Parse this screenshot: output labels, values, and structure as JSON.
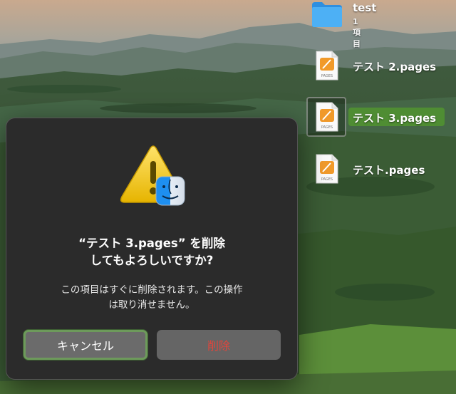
{
  "desktop": {
    "folder": {
      "name": "test",
      "count": "1項目",
      "icon": "folder-icon"
    },
    "files": [
      {
        "name": "テスト 2.pages",
        "icon_badge": "PAGES",
        "selected": false
      },
      {
        "name": "テスト 3.pages",
        "icon_badge": "PAGES",
        "selected": true
      },
      {
        "name": "テスト.pages",
        "icon_badge": "PAGES",
        "selected": false
      }
    ]
  },
  "dialog": {
    "icon": "warning-finder-icon",
    "title_line1": "“テスト 3.pages” を削除",
    "title_line2": "してもよろしいですか?",
    "message_line1": "この項目はすぐに削除されます。この操作",
    "message_line2": "は取り消せません。",
    "buttons": {
      "cancel": "キャンセル",
      "delete": "削除"
    }
  },
  "colors": {
    "selection_green": "#4f8d33",
    "focus_ring": "#6d9a5b",
    "destructive_red": "#e0463c",
    "dialog_bg": "#2b2b2b",
    "folder_blue": "#3ea7ef",
    "pages_orange": "#f19a2a"
  }
}
